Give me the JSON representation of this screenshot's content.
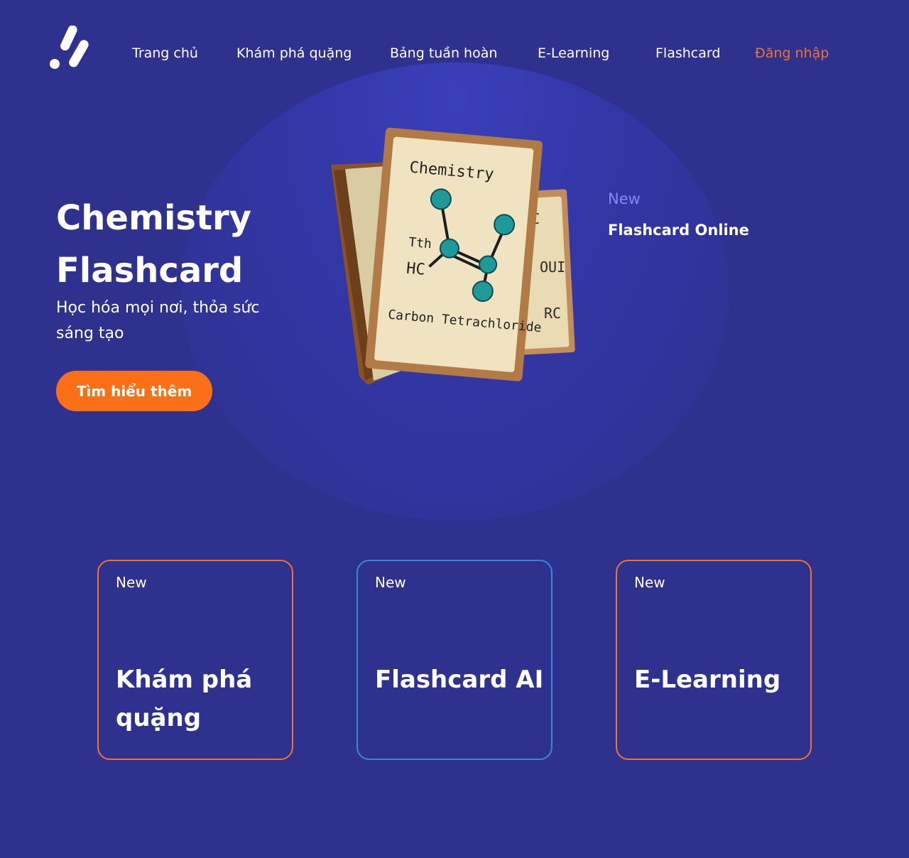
{
  "nav": {
    "items": [
      "Trang chủ",
      "Khám phá quặng",
      "Bảng tuần hoàn",
      "E-Learning",
      "Flashcard"
    ],
    "login": "Đăng nhập"
  },
  "hero": {
    "title_line1": "Chemistry",
    "title_line2": "Flashcard",
    "subtitle": "Học hóa mọi nơi, thỏa sức sáng tạo",
    "cta": "Tìm hiểu thêm"
  },
  "illustration": {
    "heading": "Chemistry",
    "label_tth": "Tth",
    "label_hc": "HC",
    "caption": "Carbon Tetrachloride",
    "side_fragments": [
      "C",
      "OUI",
      "RC"
    ]
  },
  "side_panel": {
    "badge": "New",
    "title": "Flashcard Online"
  },
  "cards": [
    {
      "badge": "New",
      "title": "Khám phá quặng"
    },
    {
      "badge": "New",
      "title": "Flashcard AI"
    },
    {
      "badge": "New",
      "title": "E-Learning"
    }
  ],
  "colors": {
    "background": "#2e318e",
    "accent_orange": "#fb6f17",
    "card_blue_border": "#3a87d9",
    "new_badge_blue": "#7d8cf5"
  }
}
